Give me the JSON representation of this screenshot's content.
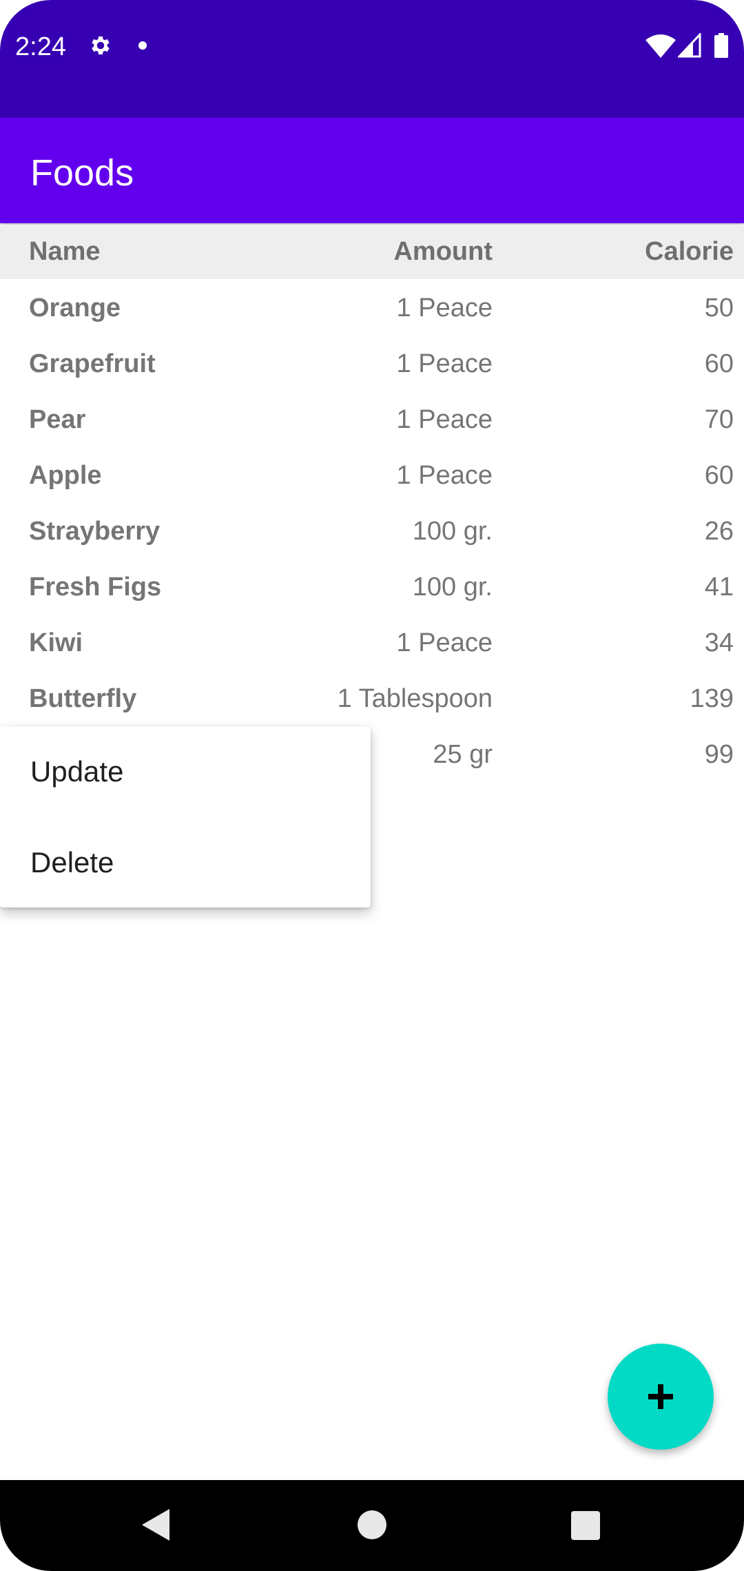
{
  "status_bar": {
    "time": "2:24"
  },
  "app_bar": {
    "title": "Foods"
  },
  "table": {
    "headers": {
      "name": "Name",
      "amount": "Amount",
      "calorie": "Calorie"
    },
    "rows": [
      {
        "name": "Orange",
        "amount": "1 Peace",
        "calorie": "50"
      },
      {
        "name": "Grapefruit",
        "amount": "1 Peace",
        "calorie": "60"
      },
      {
        "name": "Pear",
        "amount": "1 Peace",
        "calorie": "70"
      },
      {
        "name": "Apple",
        "amount": "1 Peace",
        "calorie": "60"
      },
      {
        "name": "Strayberry",
        "amount": "100 gr.",
        "calorie": "26"
      },
      {
        "name": "Fresh Figs",
        "amount": "100 gr.",
        "calorie": "41"
      },
      {
        "name": "Kiwi",
        "amount": "1 Peace",
        "calorie": "34"
      },
      {
        "name": "Butterfly",
        "amount": "1 Tablespoon",
        "calorie": "139"
      },
      {
        "name": "",
        "amount": "25 gr",
        "calorie": "99"
      }
    ]
  },
  "context_menu": {
    "items": [
      {
        "label": "Update"
      },
      {
        "label": "Delete"
      }
    ]
  },
  "fab": {
    "icon": "plus-icon"
  },
  "colors": {
    "status_bar": "#3700b3",
    "app_bar": "#6200ee",
    "fab": "#03dac5",
    "header_bg": "#eeeeee"
  }
}
